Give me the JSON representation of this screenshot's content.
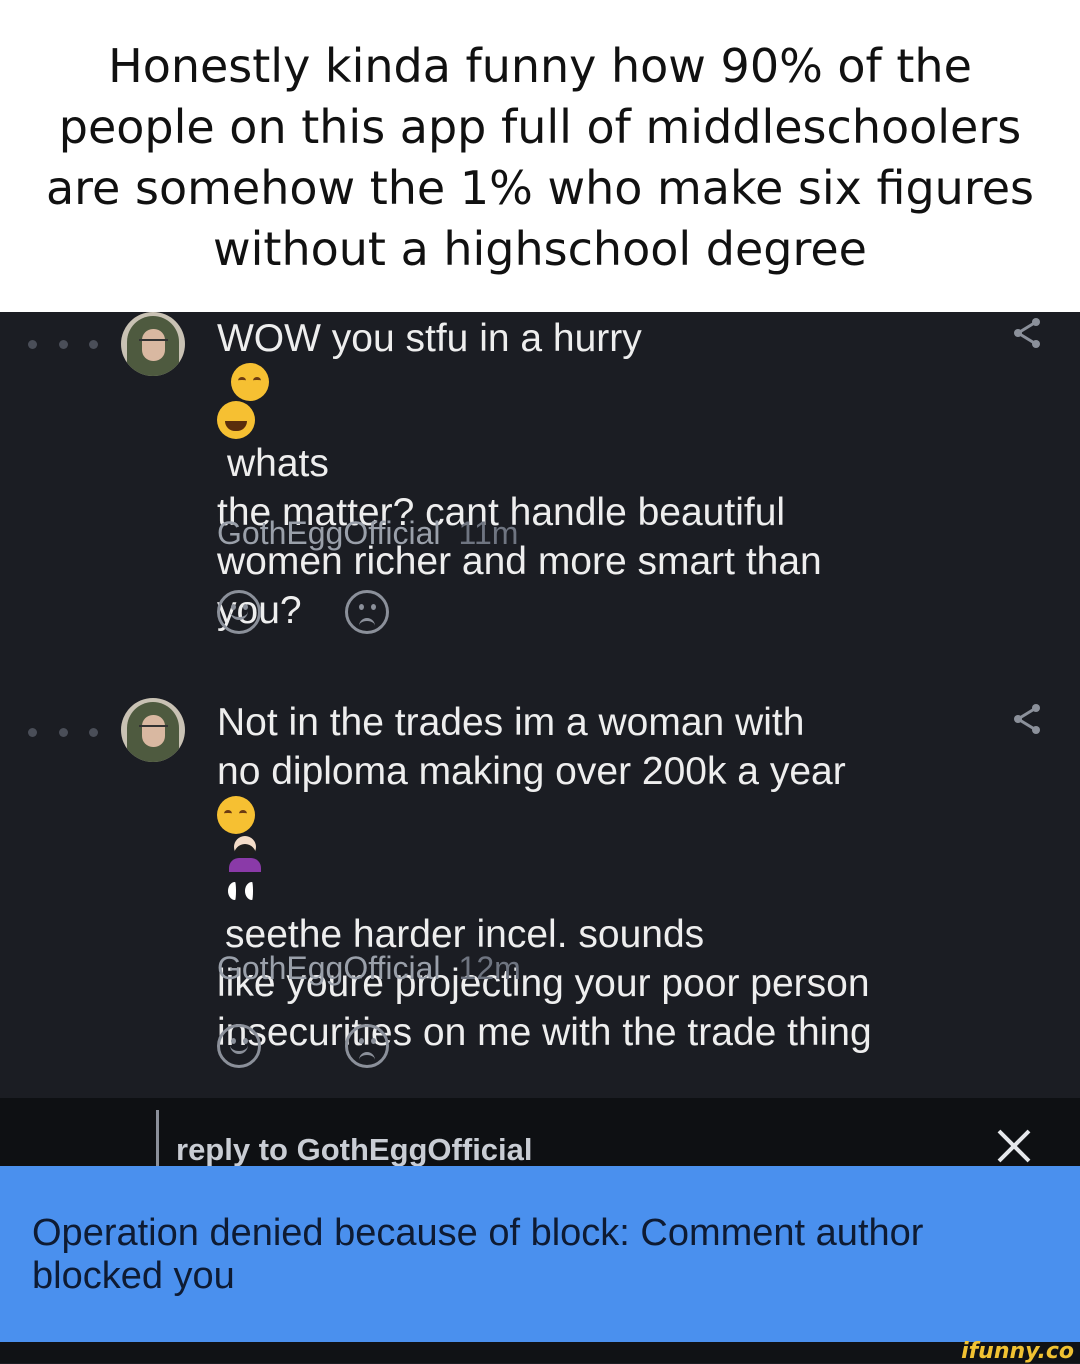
{
  "caption": {
    "lines": [
      "Honestly kinda funny how 90% of the",
      "people on this app full of middleschoolers",
      "are somehow the 1% who make six figures",
      "without a highschool degree"
    ]
  },
  "comments": [
    {
      "text_lines": [
        "WOW you stfu in a hurry",
        "whats",
        "the matter? cant handle beautiful",
        "women richer and more smart than",
        "you?"
      ],
      "emojis": [
        "hand-over-mouth-emoji",
        "tears-of-joy-emoji"
      ],
      "author": "GothEggOfficial",
      "time": "11m"
    },
    {
      "text_lines": [
        "Not in the trades im a woman with",
        "no diploma making over 200k a year",
        "seethe harder incel. sounds",
        "like youre projecting your poor person",
        "insecurities on me with the trade thing"
      ],
      "emojis": [
        "hand-over-mouth-emoji",
        "person-facepalming-emoji",
        "eyes-emoji"
      ],
      "author": "GothEggOfficial",
      "time": "12m"
    }
  ],
  "reply": {
    "label": "reply to GothEggOfficial"
  },
  "toast": {
    "message": "Operation denied because of block: Comment author blocked you"
  },
  "watermark": "ifunny.co",
  "colors": {
    "background": "#1b1d23",
    "toast": "#4a90ee",
    "caption_bg": "#ffffff"
  }
}
